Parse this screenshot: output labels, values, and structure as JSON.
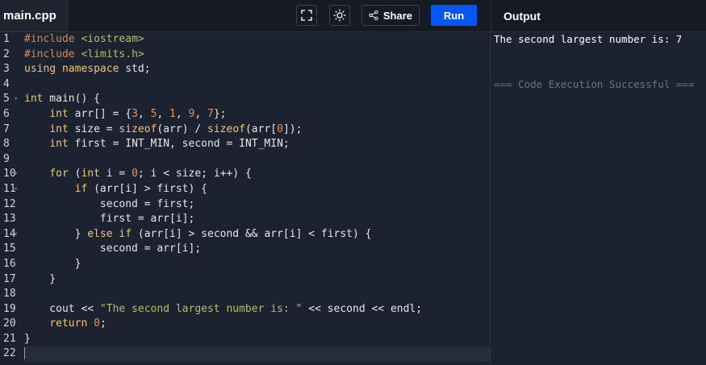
{
  "header": {
    "file_tab": "main.cpp",
    "share_label": "Share",
    "run_label": "Run",
    "output_title": "Output"
  },
  "editor": {
    "lines": [
      [
        [
          "pp",
          "#include "
        ],
        [
          "st",
          "<iostream>"
        ]
      ],
      [
        [
          "pp",
          "#include "
        ],
        [
          "st",
          "<limits.h>"
        ]
      ],
      [
        [
          "kw",
          "using namespace"
        ],
        [
          "op",
          " std;"
        ]
      ],
      [],
      [
        [
          "ty",
          "int"
        ],
        [
          "op",
          " main() {"
        ]
      ],
      [
        [
          "op",
          "    "
        ],
        [
          "ty",
          "int"
        ],
        [
          "op",
          " arr[] = {"
        ],
        [
          "nm",
          "3"
        ],
        [
          "op",
          ", "
        ],
        [
          "nm",
          "5"
        ],
        [
          "op",
          ", "
        ],
        [
          "nm",
          "1"
        ],
        [
          "op",
          ", "
        ],
        [
          "nm",
          "9"
        ],
        [
          "op",
          ", "
        ],
        [
          "nm",
          "7"
        ],
        [
          "op",
          "};"
        ]
      ],
      [
        [
          "op",
          "    "
        ],
        [
          "ty",
          "int"
        ],
        [
          "op",
          " size = "
        ],
        [
          "kw",
          "sizeof"
        ],
        [
          "op",
          "(arr) / "
        ],
        [
          "kw",
          "sizeof"
        ],
        [
          "op",
          "(arr["
        ],
        [
          "nm",
          "0"
        ],
        [
          "op",
          "]);"
        ]
      ],
      [
        [
          "op",
          "    "
        ],
        [
          "ty",
          "int"
        ],
        [
          "op",
          " first = INT_MIN, second = INT_MIN;"
        ]
      ],
      [],
      [
        [
          "op",
          "    "
        ],
        [
          "kw",
          "for"
        ],
        [
          "op",
          " ("
        ],
        [
          "ty",
          "int"
        ],
        [
          "op",
          " i = "
        ],
        [
          "nm",
          "0"
        ],
        [
          "op",
          "; i < size; i++) {"
        ]
      ],
      [
        [
          "op",
          "        "
        ],
        [
          "kw",
          "if"
        ],
        [
          "op",
          " (arr[i] > first) {"
        ]
      ],
      [
        [
          "op",
          "            second = first;"
        ]
      ],
      [
        [
          "op",
          "            first = arr[i];"
        ]
      ],
      [
        [
          "op",
          "        } "
        ],
        [
          "kw",
          "else if"
        ],
        [
          "op",
          " (arr[i] > second && arr[i] < first) {"
        ]
      ],
      [
        [
          "op",
          "            second = arr[i];"
        ]
      ],
      [
        [
          "op",
          "        }"
        ]
      ],
      [
        [
          "op",
          "    }"
        ]
      ],
      [],
      [
        [
          "op",
          "    cout << "
        ],
        [
          "st",
          "\"The second largest number is: \""
        ],
        [
          "op",
          " << second << endl;"
        ]
      ],
      [
        [
          "op",
          "    "
        ],
        [
          "kw",
          "return"
        ],
        [
          "op",
          " "
        ],
        [
          "nm",
          "0"
        ],
        [
          "op",
          ";"
        ]
      ],
      [
        [
          "op",
          "}"
        ]
      ],
      []
    ],
    "fold_lines": [
      5,
      10,
      11,
      14
    ]
  },
  "output": {
    "lines": [
      "The second largest number is: 7",
      "",
      "",
      "=== Code Execution Successful ==="
    ]
  },
  "colors": {
    "run_button": "#0556f3",
    "background": "#1d2230"
  }
}
